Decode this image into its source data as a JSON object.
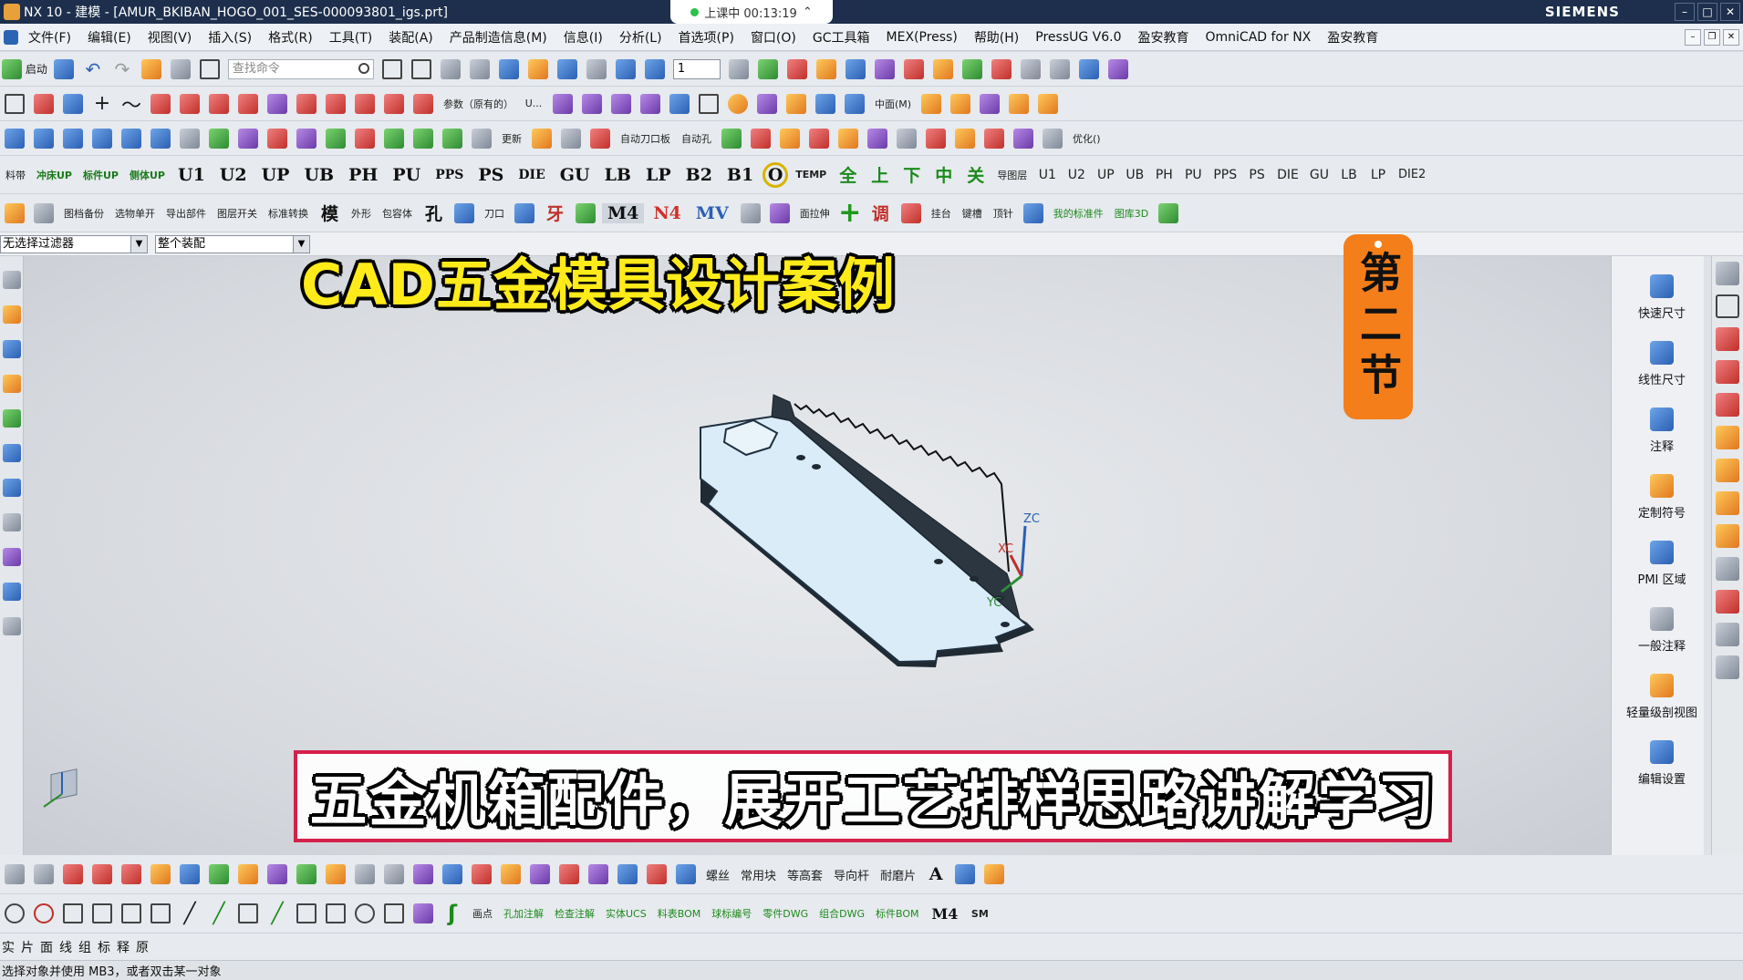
{
  "window": {
    "title": "NX 10 - 建模 - [AMUR_BKIBAN_HOGO_001_SES-000093801_igs.prt]",
    "brand": "SIEMENS",
    "recording_label": "上课中 00:13:19"
  },
  "menu": {
    "items": [
      "文件(F)",
      "编辑(E)",
      "视图(V)",
      "插入(S)",
      "格式(R)",
      "工具(T)",
      "装配(A)",
      "产品制造信息(M)",
      "信息(I)",
      "分析(L)",
      "首选项(P)",
      "窗口(O)",
      "GC工具箱",
      "MEX(Press)",
      "帮助(H)",
      "PressUG V6.0",
      "盈安教育",
      "OmniCAD for NX",
      "盈安教育"
    ]
  },
  "toolbar1": {
    "start_label": "启动",
    "search_placeholder": "查找命令",
    "layer_value": "1"
  },
  "toolbar2": {
    "param_label": "参数（原有的）",
    "u_label": "U...",
    "center_label": "中面(M)"
  },
  "toolbar3": {
    "auto_blade": "自动刀口板",
    "auto_hole": "自动孔",
    "optimize": "优化()",
    "update": "更新"
  },
  "toolbar4": {
    "labels": [
      "料带",
      "冲床UP",
      "标件UP",
      "侧体UP",
      "U1",
      "U2",
      "UP",
      "UB",
      "PH",
      "PU",
      "PPS",
      "PS",
      "DIE",
      "GU",
      "LB",
      "LP",
      "B2",
      "B1",
      "O",
      "TEMP",
      "全",
      "上",
      "下",
      "中",
      "关",
      "导图层"
    ],
    "right_labels": [
      "U1",
      "U2",
      "UP",
      "UB",
      "PH",
      "PU",
      "PPS",
      "PS",
      "DIE",
      "GU",
      "LB",
      "LP",
      "DIE2"
    ]
  },
  "toolbar5": {
    "labels": [
      "图档备份",
      "选物单开",
      "导出部件",
      "图层开关",
      "标准转换",
      "模",
      "外形",
      "包容体",
      "孔",
      "刀口",
      "牙",
      "M4",
      "N4",
      "MV",
      "面拉伸",
      "调",
      "挂台",
      "键槽",
      "顶针",
      "我的标准件",
      "图库3D"
    ]
  },
  "filter": {
    "selection_filter": "无选择过滤器",
    "scope": "整个装配"
  },
  "overlay": {
    "title": "CAD五金模具设计案例",
    "section": "第二节",
    "subtitle": "五金机箱配件，展开工艺排样思路讲解学习"
  },
  "pmi_panel": {
    "items": [
      "快速尺寸",
      "线性尺寸",
      "注释",
      "定制符号",
      "PMI 区域",
      "一般注释",
      "轻量级剖视图",
      "编辑设置"
    ]
  },
  "axes": {
    "zc": "ZC",
    "xc": "XC",
    "yc": "YC"
  },
  "bottom_toolbar": {
    "labels": [
      "螺丝",
      "常用块",
      "等高套",
      "导向杆",
      "耐磨片",
      "A"
    ]
  },
  "bottom_toolbar2": {
    "labels": [
      "画点",
      "孔加注解",
      "检查注解",
      "实体UCS",
      "料表BOM",
      "球标编号",
      "零件DWG",
      "组合DWG",
      "标件BOM",
      "M4",
      "SM"
    ]
  },
  "selection_bar": {
    "text": "实片面线组标释原"
  },
  "status": {
    "text": "选择对象并使用 MB3，或者双击某一对象"
  },
  "colors": {
    "title_bar": "#1d2f4c",
    "overlay_title": "#ffeb1a",
    "badge": "#f47e1a",
    "subtitle_border": "#d6204b",
    "part_face": "#d9ecf7"
  }
}
